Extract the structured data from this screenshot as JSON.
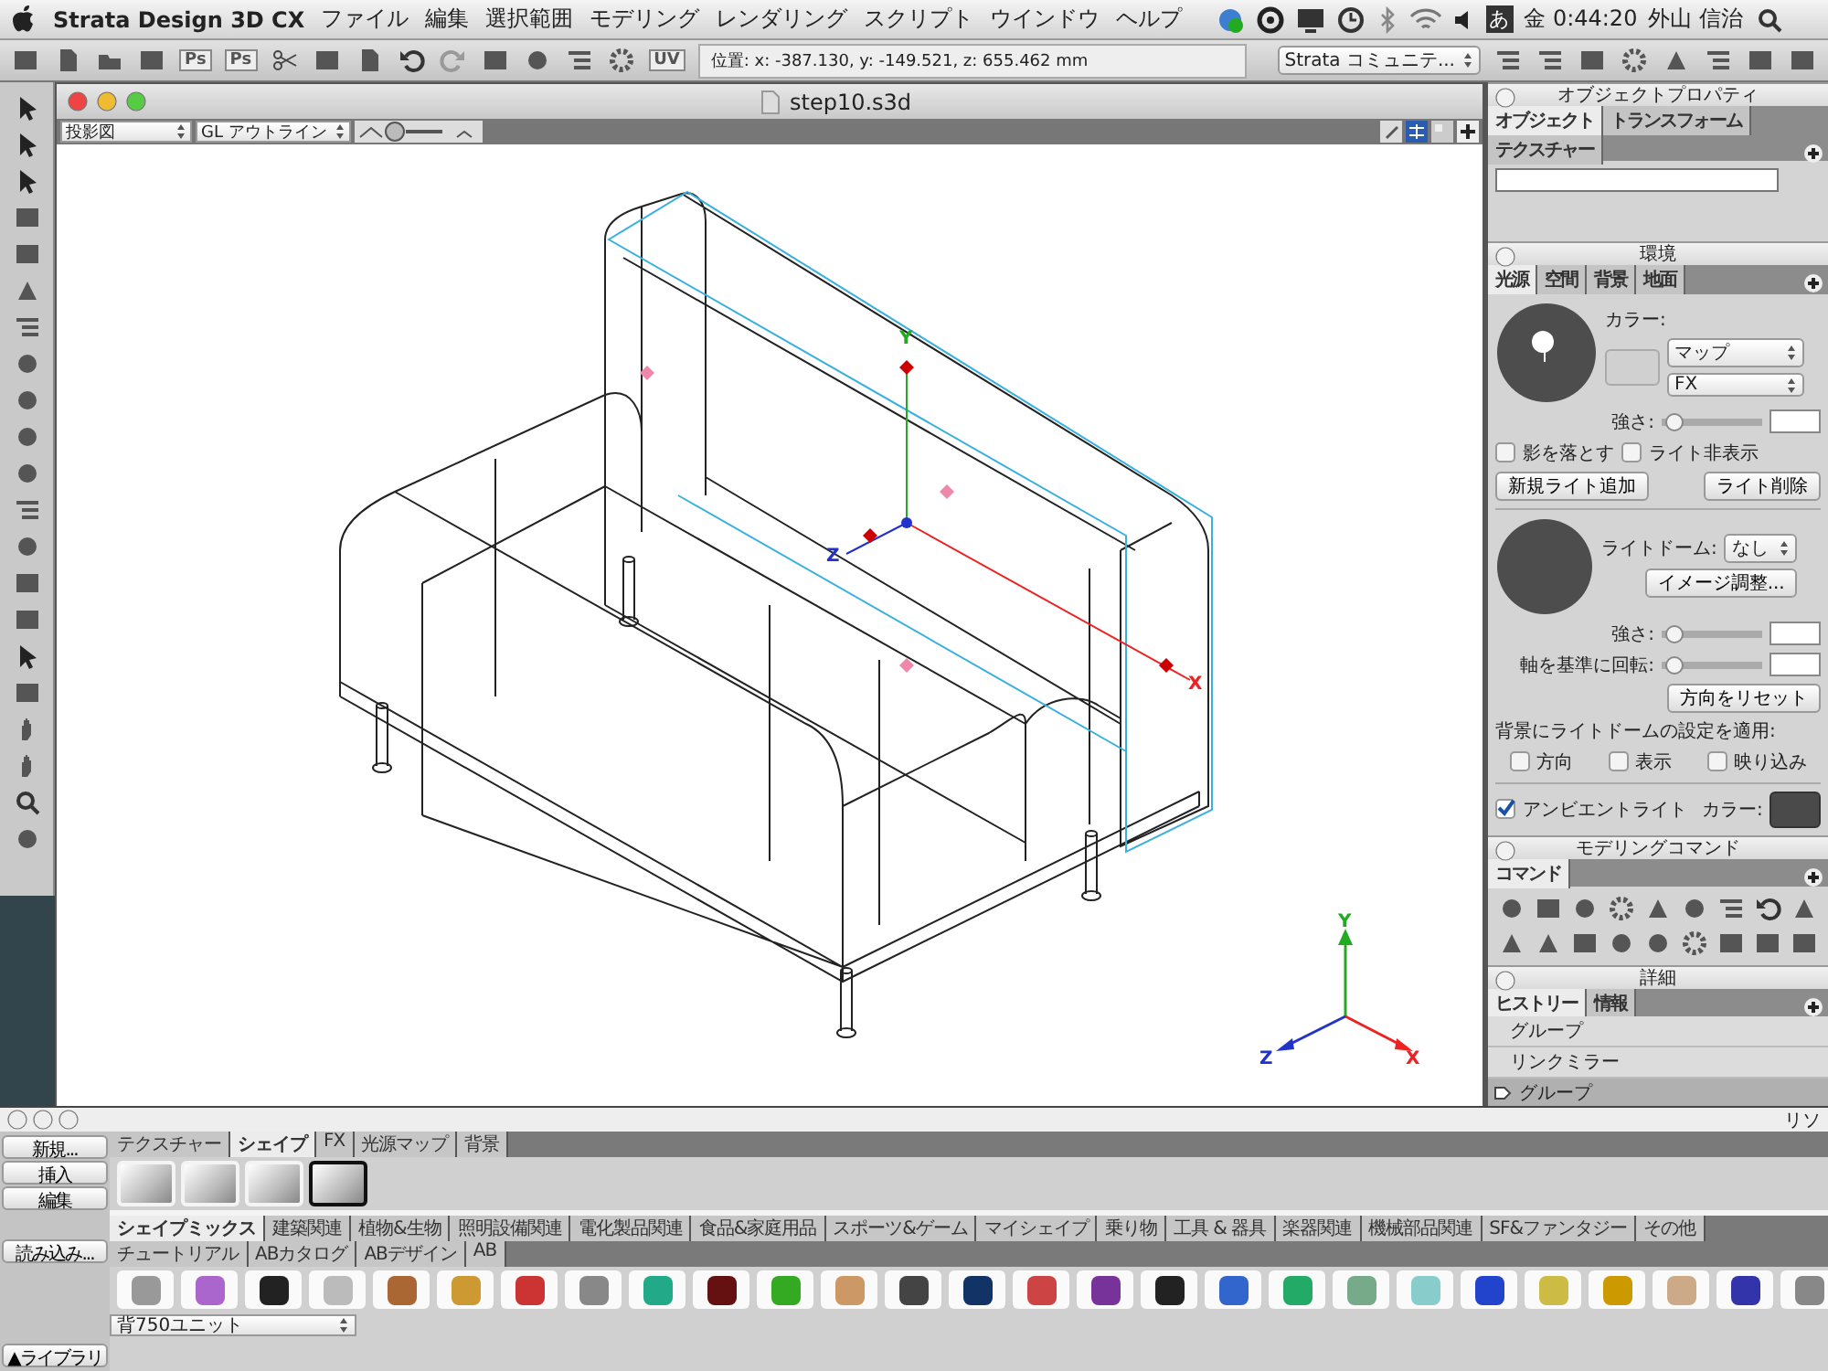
{
  "menu_bar": {
    "app_name": "Strata Design 3D CX",
    "menus": [
      "ファイル",
      "編集",
      "選択範囲",
      "モデリング",
      "レンダリング",
      "スクリプト",
      "ウインドウ",
      "ヘルプ"
    ],
    "input_method": "あ",
    "clock": "金 0:44:20",
    "user": "外山 信治"
  },
  "toolbar": {
    "ps_buttons": [
      "Ps",
      "Ps"
    ],
    "uv_button": "UV",
    "position_readout": "位置: x: -387.130, y: -149.521, z: 655.462 mm",
    "community_menu": "Strata コミュニテ..."
  },
  "document": {
    "title": "step10.s3d",
    "view_menu": "投影図",
    "render_menu": "GL アウトライン",
    "manipulator_labels": [
      "Y",
      "Z",
      "X"
    ],
    "axis_labels": [
      "Y",
      "Z",
      "X"
    ]
  },
  "object_properties": {
    "title": "オブジェクトプロパティ",
    "tabs": [
      {
        "label": "オブジェクト",
        "selected": true
      },
      {
        "label": "トランスフォーム",
        "selected": false
      },
      {
        "label": "テクスチャー",
        "selected": false
      }
    ]
  },
  "environment": {
    "title": "環境",
    "tabs": [
      {
        "label": "光源",
        "selected": true
      },
      {
        "label": "空間",
        "selected": false
      },
      {
        "label": "背景",
        "selected": false
      },
      {
        "label": "地面",
        "selected": false
      }
    ],
    "color_label": "カラー:",
    "map_menu": "マップ",
    "fx_menu": "FX",
    "strength": {
      "label": "強さ:",
      "level": 0.05
    },
    "checkboxes": [
      {
        "label": "影を落とす",
        "checked": false
      },
      {
        "label": "ライト非表示",
        "checked": false
      }
    ],
    "buttons": [
      "新規ライト追加",
      "ライト削除"
    ],
    "light_dome_label": "ライトドーム:",
    "light_dome_menu": "なし",
    "image_button": "イメージ調整...",
    "dome_sliders": [
      {
        "label": "強さ:",
        "level": 0.05
      },
      {
        "label": "軸を基準に回転:",
        "level": 0.05
      }
    ],
    "reset_button": "方向をリセット",
    "apply_label": "背景にライトドームの設定を適用:",
    "apply_checkboxes": [
      {
        "label": "方向",
        "checked": false
      },
      {
        "label": "表示",
        "checked": false
      },
      {
        "label": "映り込み",
        "checked": false
      }
    ],
    "ambient": {
      "label": "アンビエントライト",
      "checked": true
    },
    "ambient_color_label": "カラー:"
  },
  "modeling_commands": {
    "title": "モデリングコマンド",
    "tabs": [
      {
        "label": "コマンド",
        "selected": true
      }
    ]
  },
  "details": {
    "title": "詳細",
    "tabs": [
      {
        "label": "ヒストリー",
        "selected": true
      },
      {
        "label": "情報",
        "selected": false
      }
    ],
    "history": [
      {
        "label": "グループ",
        "selected": false
      },
      {
        "label": "リンクミラー",
        "selected": false
      },
      {
        "label": "グループ",
        "selected": true
      }
    ]
  },
  "library": {
    "side_buttons": [
      "新規...",
      "挿入",
      "編集"
    ],
    "load_button": "読み込み...",
    "library_button": "▲ライブラリ",
    "right_label": "リソ",
    "tabs": [
      {
        "label": "テクスチャー",
        "selected": false
      },
      {
        "label": "シェイプ",
        "selected": true
      },
      {
        "label": "FX",
        "selected": false
      },
      {
        "label": "光源マップ",
        "selected": false
      },
      {
        "label": "背景",
        "selected": false
      }
    ],
    "shapes": [
      {
        "selected": false
      },
      {
        "selected": false
      },
      {
        "selected": false
      },
      {
        "selected": true
      }
    ],
    "catalog_tabs": [
      {
        "label": "シェイプミックス",
        "selected": true
      },
      {
        "label": "建築関連",
        "selected": false
      },
      {
        "label": "植物&生物",
        "selected": false
      },
      {
        "label": "照明設備関連",
        "selected": false
      },
      {
        "label": "電化製品関連",
        "selected": false
      },
      {
        "label": "食品&家庭用品",
        "selected": false
      },
      {
        "label": "スポーツ&ゲーム",
        "selected": false
      },
      {
        "label": "マイシェイプ",
        "selected": false
      },
      {
        "label": "乗り物",
        "selected": false
      },
      {
        "label": "工具 & 器具",
        "selected": false
      },
      {
        "label": "楽器関連",
        "selected": false
      },
      {
        "label": "機械部品関連",
        "selected": false
      },
      {
        "label": "SF&ファンタジー",
        "selected": false
      },
      {
        "label": "その他",
        "selected": false
      },
      {
        "label": "チュートリアル",
        "selected": false
      },
      {
        "label": "ABカタログ",
        "selected": false
      },
      {
        "label": "ABデザイン",
        "selected": false
      },
      {
        "label": "AB",
        "selected": false
      }
    ],
    "unit_menu": "背750ユニット"
  }
}
